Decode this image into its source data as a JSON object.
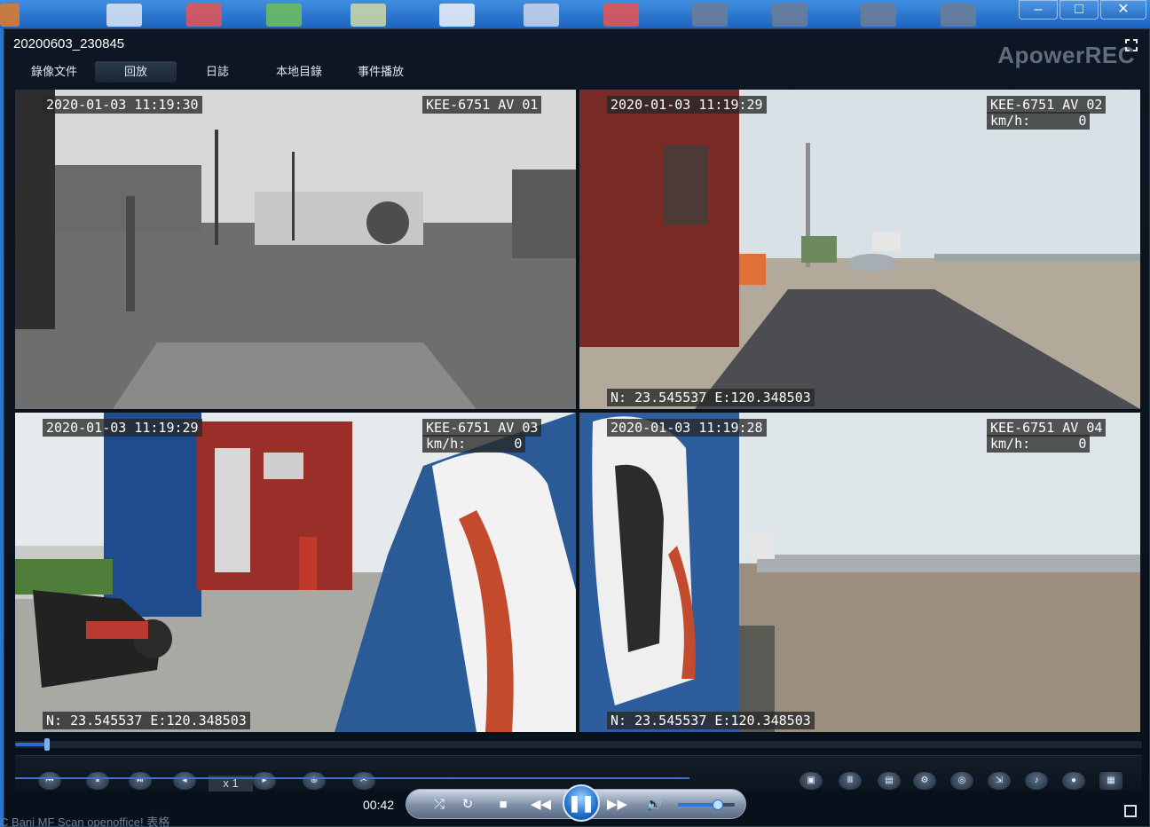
{
  "window": {
    "title": "20200603_230845",
    "brand": "ApowerREC",
    "minimize_glyph": "–",
    "maximize_glyph": "□",
    "close_glyph": "✕"
  },
  "menu": [
    {
      "label": "錄像文件",
      "active": false
    },
    {
      "label": "回放",
      "active": true
    },
    {
      "label": "日誌",
      "active": false
    },
    {
      "label": "本地目錄",
      "active": false
    },
    {
      "label": "事件播放",
      "active": false
    }
  ],
  "channels": [
    {
      "timestamp": "2020-01-03 11:19:30",
      "plate": "KEE-6751 AV 01",
      "speed": "",
      "gps": ""
    },
    {
      "timestamp": "2020-01-03 11:19:29",
      "plate": "KEE-6751 AV 02",
      "speed": "km/h:      0",
      "gps": "N: 23.545537 E:120.348503"
    },
    {
      "timestamp": "2020-01-03 11:19:29",
      "plate": "KEE-6751 AV 03",
      "speed": "km/h:      0",
      "gps": "N: 23.545537 E:120.348503"
    },
    {
      "timestamp": "2020-01-03 11:19:28",
      "plate": "KEE-6751 AV 04",
      "speed": "km/h:      0",
      "gps": "N: 23.545537 E:120.348503"
    }
  ],
  "selected_channel": 2,
  "playback": {
    "speed_label": "x 1",
    "elapsed": "00:42",
    "seek_fraction": 0.028,
    "volume_fraction": 0.7
  },
  "icons": {
    "play_pause": "pause-icon",
    "shuffle": "shuffle-icon",
    "repeat": "repeat-icon",
    "stop": "stop-icon",
    "prev": "rewind-icon",
    "next": "fast-forward-icon",
    "volume": "volume-icon"
  },
  "desktop_hint": "C Bani   MF Scan   openoffice!   表格"
}
